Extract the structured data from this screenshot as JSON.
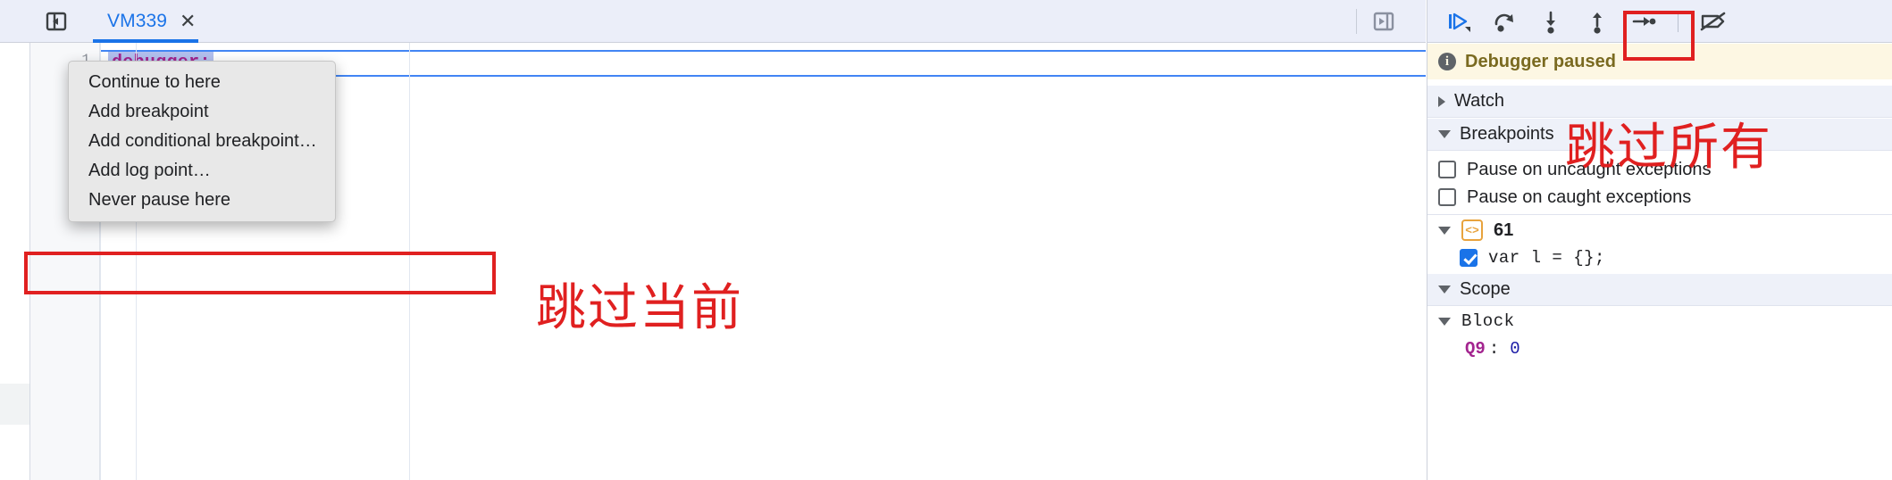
{
  "editor": {
    "tab": {
      "label": "VM339",
      "close_icon": "close-icon"
    },
    "nav_toggle_icon": "show-navigator-icon",
    "expand_icon": "show-debugger-sidebar-icon",
    "line_number": "1",
    "code": "debugger;"
  },
  "context_menu": {
    "items": [
      {
        "label": "Continue to here"
      },
      {
        "label": "Add breakpoint"
      },
      {
        "label": "Add conditional breakpoint…"
      },
      {
        "label": "Add log point…"
      },
      {
        "label": "Never pause here"
      }
    ]
  },
  "annotations": {
    "skip_current": "跳过当前",
    "skip_all": "跳过所有",
    "highlight_color": "#e02020"
  },
  "debugger": {
    "toolbar": [
      {
        "name": "resume-script-execution",
        "icon": "resume-icon"
      },
      {
        "name": "step-over-next-function-call",
        "icon": "step-over-icon"
      },
      {
        "name": "step-into-next-function-call",
        "icon": "step-into-icon"
      },
      {
        "name": "step-out-of-current-function",
        "icon": "step-out-icon"
      },
      {
        "name": "step",
        "icon": "step-icon"
      },
      {
        "name": "deactivate-breakpoints",
        "icon": "deactivate-breakpoints-icon"
      }
    ],
    "status": {
      "icon": "info-icon",
      "text": "Debugger paused"
    },
    "sections": {
      "watch": {
        "label": "Watch",
        "expanded": false
      },
      "breakpoints": {
        "label": "Breakpoints",
        "expanded": true
      },
      "scope": {
        "label": "Scope",
        "expanded": true
      }
    },
    "exception_options": [
      {
        "label": "Pause on uncaught exceptions",
        "checked": false
      },
      {
        "label": "Pause on caught exceptions",
        "checked": false
      }
    ],
    "breakpoint_group": {
      "script_icon": "script-file-icon",
      "name": "61",
      "entries": [
        {
          "label": "var l = {};",
          "checked": true
        }
      ]
    },
    "scope": {
      "block_label": "Block",
      "vars": [
        {
          "key": "Q9",
          "colon": ":",
          "value": "0"
        }
      ]
    }
  }
}
